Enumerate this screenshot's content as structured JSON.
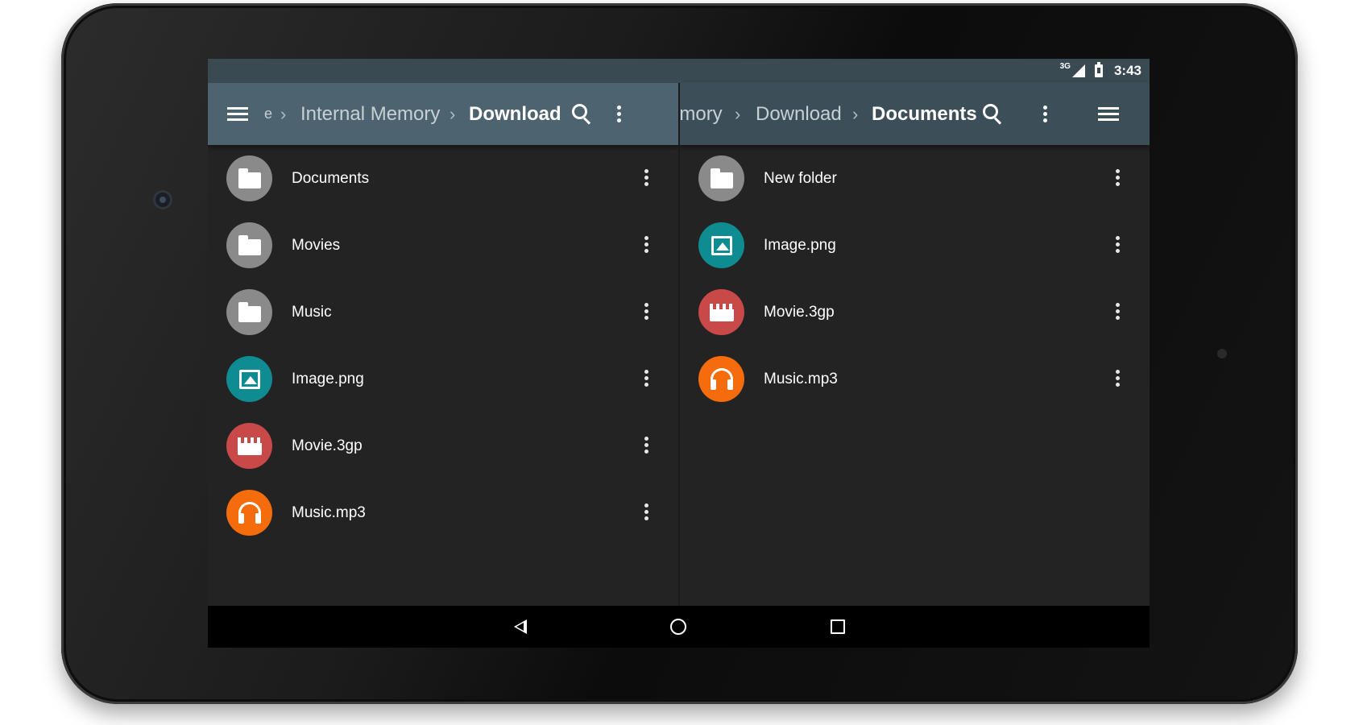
{
  "status_bar": {
    "network": "3G",
    "time": "3:43"
  },
  "left_pane": {
    "breadcrumbs": [
      {
        "label": "e"
      },
      {
        "label": "Internal Memory"
      },
      {
        "label": "Download"
      }
    ],
    "items": [
      {
        "name": "Documents",
        "type": "folder",
        "icon": "folder-icon",
        "color": "#8a8a8a"
      },
      {
        "name": "Movies",
        "type": "folder",
        "icon": "folder-icon",
        "color": "#8a8a8a"
      },
      {
        "name": "Music",
        "type": "folder",
        "icon": "folder-icon",
        "color": "#8a8a8a"
      },
      {
        "name": "Image.png",
        "type": "image",
        "icon": "image-icon",
        "color": "#0f8c91"
      },
      {
        "name": "Movie.3gp",
        "type": "video",
        "icon": "movie-icon",
        "color": "#c94848"
      },
      {
        "name": "Music.mp3",
        "type": "audio",
        "icon": "headphones-icon",
        "color": "#f56c0c"
      }
    ]
  },
  "right_pane": {
    "breadcrumbs": [
      {
        "label": "emory"
      },
      {
        "label": "Download"
      },
      {
        "label": "Documents"
      }
    ],
    "items": [
      {
        "name": "New folder",
        "type": "folder",
        "icon": "folder-icon",
        "color": "#8a8a8a"
      },
      {
        "name": "Image.png",
        "type": "image",
        "icon": "image-icon",
        "color": "#0f8c91"
      },
      {
        "name": "Movie.3gp",
        "type": "video",
        "icon": "movie-icon",
        "color": "#c94848"
      },
      {
        "name": "Music.mp3",
        "type": "audio",
        "icon": "headphones-icon",
        "color": "#f56c0c"
      }
    ]
  },
  "colors": {
    "toolbar_left": "#4d6470",
    "toolbar_right": "#3c4f59",
    "status_bar": "#394a53",
    "background": "#232323"
  }
}
